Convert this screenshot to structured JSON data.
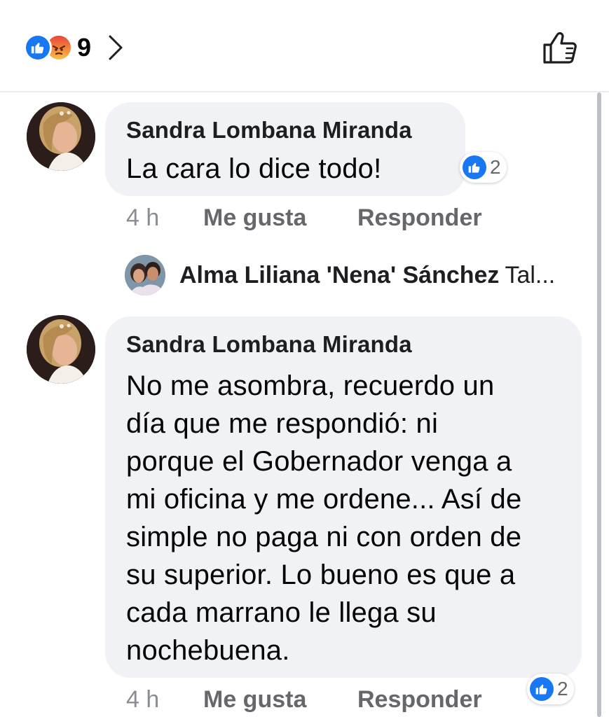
{
  "header": {
    "reactions": [
      "like",
      "angry"
    ],
    "reaction_count": "9",
    "chevron_icon": "chevron-right-icon",
    "like_button_icon": "thumbs-up-outline-icon"
  },
  "colors": {
    "like_blue": "#1877f2",
    "bubble_bg": "#f0f2f5",
    "meta_gray": "#65676b"
  },
  "comments": [
    {
      "author": "Sandra Lombana Miranda",
      "text": "La cara lo dice todo!",
      "time": "4 h",
      "like_label": "Me gusta",
      "reply_label": "Responder",
      "reaction_count": "2"
    },
    {
      "author": "Sandra Lombana Miranda",
      "text_lines": [
        "No me asombra, recuerdo un",
        "día que me respondió: ni",
        "porque el Gobernador venga a",
        "mi oficina y me ordene... Así de",
        "simple no paga ni con orden de",
        "su superior. Lo bueno es que a",
        "cada marrano le llega su",
        "nochebuena."
      ],
      "time": "4 h",
      "like_label": "Me gusta",
      "reply_label": "Responder",
      "reaction_count": "2"
    }
  ],
  "reply_preview": {
    "name": "Alma Liliana 'Nena' Sánchez",
    "snippet": "Tal..."
  }
}
